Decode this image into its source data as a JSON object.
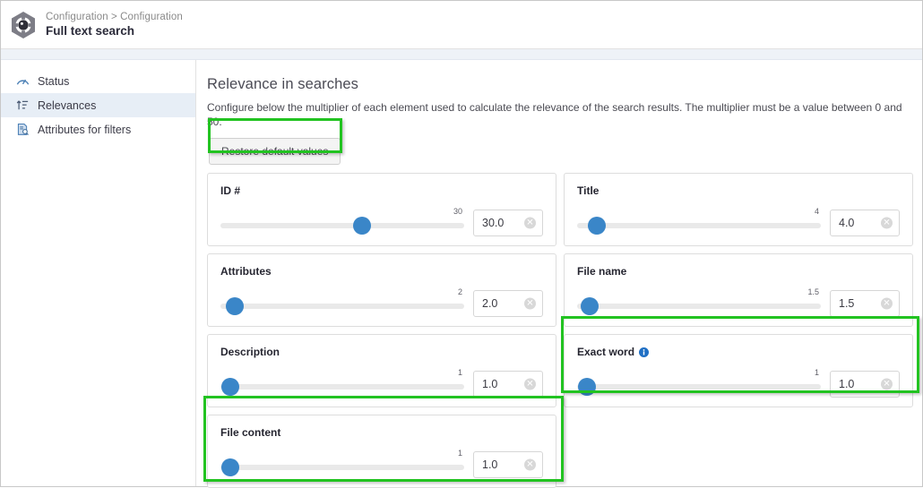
{
  "header": {
    "breadcrumb": "Configuration > Configuration",
    "title": "Full text search",
    "logo_icon": "hexagon-gear-icon"
  },
  "sidebar": {
    "items": [
      {
        "label": "Status",
        "icon": "gauge-icon",
        "selected": false
      },
      {
        "label": "Relevances",
        "icon": "sort-ascending-icon",
        "selected": true
      },
      {
        "label": "Attributes for filters",
        "icon": "document-search-icon",
        "selected": false
      }
    ]
  },
  "main": {
    "section_title": "Relevance in searches",
    "section_description": "Configure below the multiplier of each element used to calculate the relevance of the search results. The multiplier must be a value between 0 and 50.",
    "restore_button_label": "Restore default values",
    "cards": [
      {
        "label": "ID #",
        "tick": "30",
        "value": "30.0",
        "thumb_percent": 58,
        "info": false,
        "clear_icon": "clear-circle-icon",
        "highlighted": false
      },
      {
        "label": "Title",
        "tick": "4",
        "value": "4.0",
        "thumb_percent": 8,
        "info": false,
        "clear_icon": "clear-circle-icon",
        "highlighted": false
      },
      {
        "label": "Attributes",
        "tick": "2",
        "value": "2.0",
        "thumb_percent": 4,
        "info": false,
        "clear_icon": "clear-circle-icon",
        "highlighted": false
      },
      {
        "label": "File name",
        "tick": "1.5",
        "value": "1.5",
        "thumb_percent": 3,
        "info": false,
        "clear_icon": "clear-circle-icon",
        "highlighted": false
      },
      {
        "label": "Description",
        "tick": "1",
        "value": "1.0",
        "thumb_percent": 2,
        "info": false,
        "clear_icon": "clear-circle-icon",
        "highlighted": false
      },
      {
        "label": "Exact word",
        "tick": "1",
        "value": "1.0",
        "thumb_percent": 2,
        "info": true,
        "info_icon": "info-circle-icon",
        "clear_icon": "clear-circle-icon",
        "highlighted": true
      },
      {
        "label": "File content",
        "tick": "1",
        "value": "1.0",
        "thumb_percent": 2,
        "info": false,
        "clear_icon": "clear-circle-icon",
        "highlighted": true
      }
    ]
  },
  "colors": {
    "accent_blue": "#3a86c8",
    "highlight_green": "#22c321",
    "sidebar_selected": "#e7eef6",
    "strip": "#eef2f7"
  }
}
